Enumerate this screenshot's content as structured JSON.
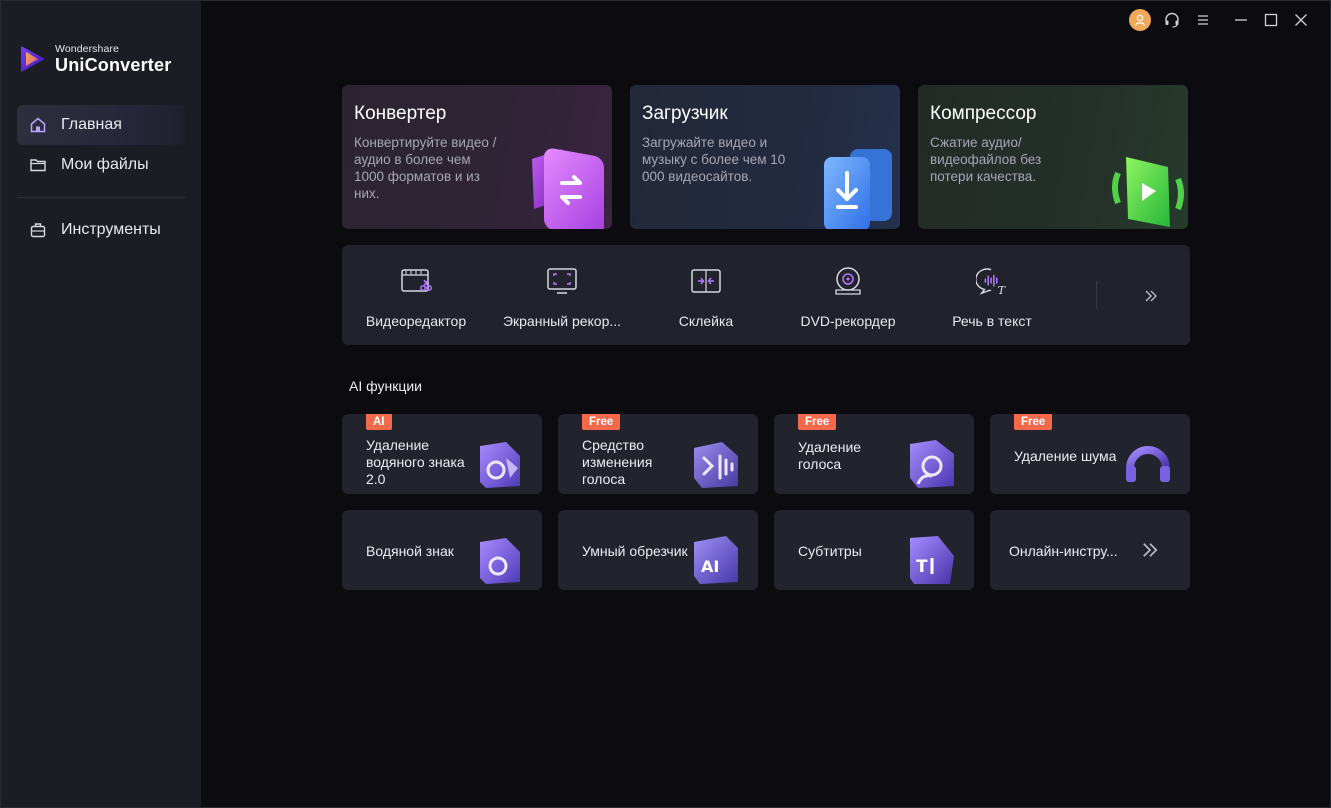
{
  "app": {
    "brand_small": "Wondershare",
    "brand_big": "UniConverter"
  },
  "sidebar": {
    "items": [
      {
        "label": "Главная",
        "icon": "home-icon",
        "active": true
      },
      {
        "label": "Мои файлы",
        "icon": "folder-icon",
        "active": false
      },
      {
        "label": "Инструменты",
        "icon": "toolbox-icon",
        "active": false
      }
    ]
  },
  "topbar": {
    "icons": [
      "avatar-icon",
      "headset-icon",
      "menu-icon",
      "minimize-icon",
      "maximize-icon",
      "close-icon"
    ]
  },
  "main_cards": [
    {
      "title": "Конвертер",
      "description": "Конвертируйте видео / аудио в более чем 1000 форматов и из них.",
      "icon": "convert-icon"
    },
    {
      "title": "Загрузчик",
      "description": "Загружайте видео и музыку с более чем 10 000 видеосайтов.",
      "icon": "download-icon"
    },
    {
      "title": "Компрессор",
      "description": "Сжатие аудио/ видеофайлов без потери качества.",
      "icon": "compress-icon"
    }
  ],
  "tools": [
    {
      "label": "Видеоредактор",
      "icon": "video-editor-icon"
    },
    {
      "label": "Экранный рекор...",
      "icon": "screen-recorder-icon"
    },
    {
      "label": "Склейка",
      "icon": "merge-icon"
    },
    {
      "label": "DVD-рекордер",
      "icon": "dvd-icon"
    },
    {
      "label": "Речь в текст",
      "icon": "speech-to-text-icon"
    }
  ],
  "ai_section": {
    "title": "AI функции",
    "items": [
      {
        "badge": "AI",
        "label": "Удаление водяного знака 2.0",
        "icon": "watermark-remover-icon"
      },
      {
        "badge": "Free",
        "label": "Средство изменения голоса",
        "icon": "voice-changer-icon"
      },
      {
        "badge": "Free",
        "label": "Удаление голоса",
        "icon": "vocal-remover-icon"
      },
      {
        "badge": "Free",
        "label": "Удаление шума",
        "icon": "noise-remover-icon"
      },
      {
        "badge": "",
        "label": "Водяной знак",
        "icon": "watermark-icon"
      },
      {
        "badge": "",
        "label": "Умный обрезчик",
        "icon": "smart-trimmer-icon"
      },
      {
        "badge": "",
        "label": "Субтитры",
        "icon": "subtitle-icon"
      },
      {
        "badge": "",
        "label": "Онлайн-инстру...",
        "icon": "chevron-double-right-icon"
      }
    ]
  },
  "colors": {
    "sidebar_bg": "#1c1c24",
    "main_bg": "#0c0c10",
    "badge": "#f26a4b",
    "accent_purple": "#9b5cf6"
  }
}
